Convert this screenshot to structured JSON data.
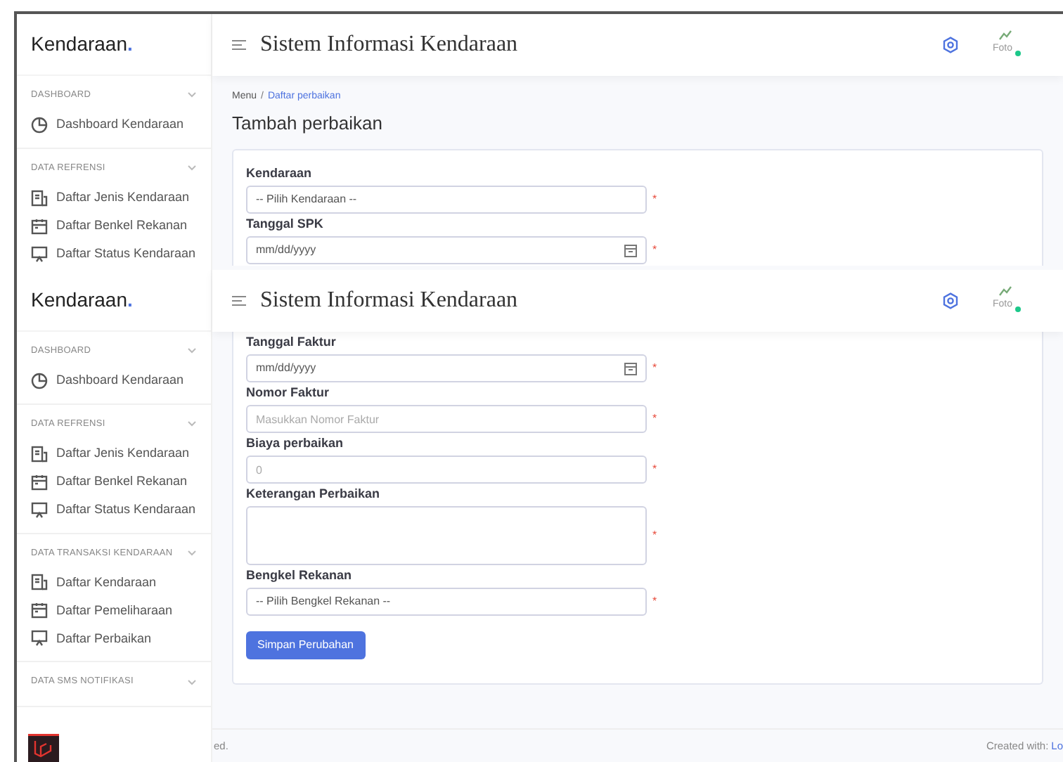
{
  "panels": [
    {
      "sidebar": {
        "logo": "Kendaraan",
        "logo_dot": ".",
        "sections": [
          {
            "title": "DASHBOARD",
            "items": [
              {
                "label": "Dashboard Kendaraan"
              }
            ]
          },
          {
            "title": "DATA REFRENSI",
            "items": [
              {
                "label": "Daftar Jenis Kendaraan"
              },
              {
                "label": "Daftar Benkel Rekanan"
              },
              {
                "label": "Daftar Status Kendaraan"
              }
            ]
          }
        ]
      },
      "header": {
        "title": "Sistem Informasi Kendaraan",
        "avatar_alt": "Foto",
        "online": true
      },
      "breadcrumb": [
        "Menu",
        "Daftar perbaikan"
      ],
      "breadcrumb_separator": "/",
      "page_title": "Tambah perbaikan",
      "form": [
        {
          "kind": "select",
          "label": "Kendaraan",
          "value": "-- Pilih Kendaraan --",
          "required_mark": "*"
        },
        {
          "kind": "date",
          "label": "Tanggal SPK",
          "value": "mm/dd/yyyy",
          "required_mark": "*"
        }
      ]
    },
    {
      "sidebar": {
        "logo": "Kendaraan",
        "logo_dot": ".",
        "sections": [
          {
            "title": "DASHBOARD",
            "items": [
              {
                "label": "Dashboard Kendaraan"
              }
            ]
          },
          {
            "title": "DATA REFRENSI",
            "items": [
              {
                "label": "Daftar Jenis Kendaraan"
              },
              {
                "label": "Daftar Benkel Rekanan"
              },
              {
                "label": "Daftar Status Kendaraan"
              }
            ]
          },
          {
            "title": "DATA TRANSAKSI KENDARAAN",
            "items": [
              {
                "label": "Daftar Kendaraan"
              },
              {
                "label": "Daftar Pemeliharaan"
              },
              {
                "label": "Daftar Perbaikan"
              }
            ]
          },
          {
            "title": "DATA SMS NOTIFIKASI"
          }
        ]
      },
      "header": {
        "title": "Sistem Informasi Kendaraan",
        "avatar_alt": "Foto",
        "online": true
      },
      "form": [
        {
          "kind": "date",
          "label": "Tanggal Faktur",
          "value": "mm/dd/yyyy",
          "required_mark": "*"
        },
        {
          "kind": "text",
          "label": "Nomor Faktur",
          "placeholder": "Masukkan Nomor Faktur",
          "required_mark": "*"
        },
        {
          "kind": "text",
          "label": "Biaya perbaikan",
          "placeholder": "0",
          "required_mark": "*"
        },
        {
          "kind": "textarea",
          "label": "Keterangan Perbaikan",
          "required_mark": "*"
        },
        {
          "kind": "select",
          "label": "Bengkel Rekanan",
          "value": "-- Pilih Bengkel Rekanan --",
          "required_mark": "*"
        }
      ],
      "submit": "Simpan Perubahan",
      "footer": {
        "left": "ed.",
        "right": "Created with:",
        "link": "Lo"
      }
    }
  ]
}
